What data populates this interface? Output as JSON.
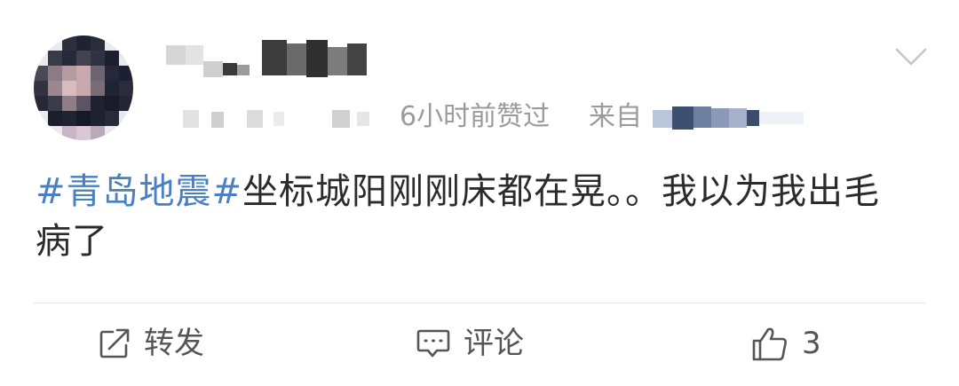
{
  "post": {
    "time_text": "6小时前赞过",
    "source_label": "来自",
    "hashtag": "#青岛地震#",
    "body_text": "坐标城阳刚刚床都在晃。。我以为我出毛病了"
  },
  "actions": {
    "repost_label": "转发",
    "comment_label": "评论",
    "like_count": "3"
  },
  "icons": {
    "more": "chevron-down-icon",
    "repost": "repost-icon",
    "comment": "comment-icon",
    "like": "thumbs-up-icon"
  },
  "colors": {
    "hashtag": "#4a7fc1",
    "meta": "#9b9b9b",
    "body": "#2b2b2b"
  }
}
